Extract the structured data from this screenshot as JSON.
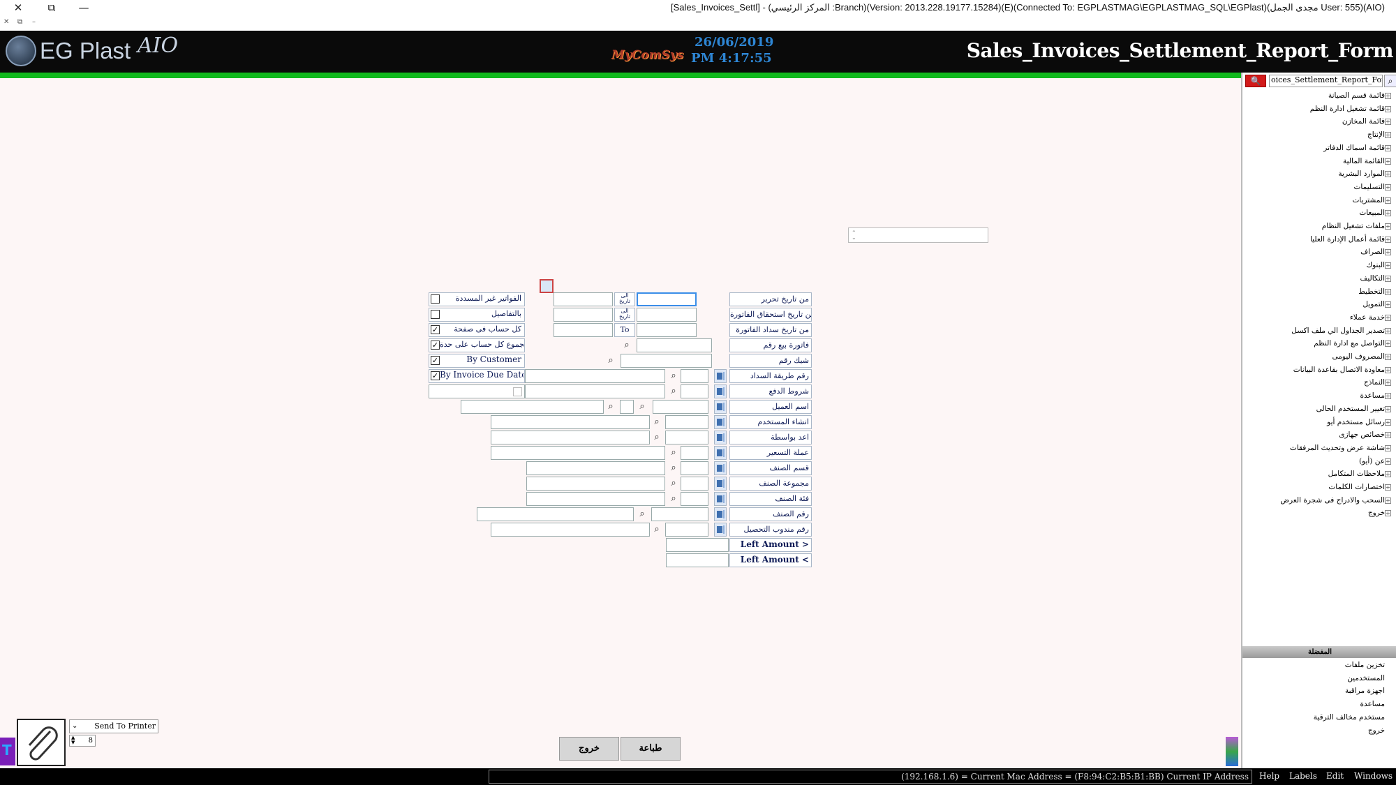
{
  "window": {
    "title": "[Sales_Invoices_Settl] - (المركز الرئيسي :Branch)(Version: 2013.228.19177.15284)(E)(Connected To: EGPLASTMAG\\EGPLASTMAG_SQL\\EGPlast)(مجدى الجمل User: 555)(AIO)",
    "close_icon": "✕",
    "restore_icon": "⧉",
    "minimize_icon": "—"
  },
  "header": {
    "logo_text": "EG Plast",
    "logo_aio": "AIO",
    "brand": "MyComSys",
    "date": "26/06/2019",
    "time": "PM 4:17:55",
    "form_title": "Sales_Invoices_Settlement_Report_Form"
  },
  "sidebar": {
    "search_value": "oices_Settlement_Report_Form",
    "search_go_icon": "search-icon",
    "tree_items": [
      "قائمة قسم الصيانة",
      "قائمة تشغيل ادارة النظم",
      "قائمة المخازن",
      "الإنتاج",
      "قائمة اسماك الدفاتر",
      "القائمة المالية",
      "الموارد البشرية",
      "التسليمات",
      "المشتريات",
      "المبيعات",
      "ملفات تشغيل النظام",
      "قائمة أعمال الإدارة العليا",
      "الصراف",
      "البنوك",
      "التكاليف",
      "التخطيط",
      "التمويل",
      "خدمة عملاء",
      "تصدير الجداول الي ملف اكسل",
      "التواصل مع ادارة النظم",
      "المصروف اليومى",
      "معاودة الاتصال بقاعدة البيانات",
      "النماذج",
      "مساعدة",
      "تغيير المستخدم الحالى",
      "رسائل مستخدم أيو",
      "خصائص جهازى",
      "شاشة عرض وتحديث المرفقات",
      "عن (أيو)",
      "ملاحظات المتكامل",
      "اختصارات الكلمات",
      "السحب والادراج فى شجرة العرض",
      "خروج"
    ],
    "favorites_header": "المفضلة",
    "favorites": [
      "تخزين ملفات",
      "المستخدمين",
      "اجهزة مراقبة",
      "مساعدة",
      "مستخدم مخالف الترقية",
      "خروج"
    ]
  },
  "form": {
    "rows": [
      {
        "label": "من تاريخ تحرير"
      },
      {
        "label": "من تاريخ استحقاق الفاتورة"
      },
      {
        "label": "من تاريخ سداد الفاتورة"
      },
      {
        "label": "فاتورة بيع رقم"
      },
      {
        "label": "شيك رقم"
      },
      {
        "label": "رقم طريقة السداد"
      },
      {
        "label": "شروط الدفع"
      },
      {
        "label": "اسم العميل"
      },
      {
        "label": "انشاء المستخدم"
      },
      {
        "label": "اعد بواسطة"
      },
      {
        "label": "عملة التسعير"
      },
      {
        "label": "قسم الصنف"
      },
      {
        "label": "مجموعة الصنف"
      },
      {
        "label": "فئة الصنف"
      },
      {
        "label": "رقم الصنف"
      },
      {
        "label": "رقم مندوب التحصيل"
      },
      {
        "label": "Left Amount >"
      },
      {
        "label": "Left Amount <"
      }
    ],
    "to_labels": [
      "الى تاريخ",
      "الى تاريخ",
      "To"
    ],
    "options": [
      {
        "label": "الفواتير غير المسددة",
        "checked": false
      },
      {
        "label": "بالتفاصيل",
        "checked": false
      },
      {
        "label": "كل حساب فى صفحة",
        "checked": true
      },
      {
        "label": "مجموع كل حساب على حدة",
        "checked": true
      },
      {
        "label": "By Customer",
        "checked": true
      },
      {
        "label": "By Invoice Due Date",
        "checked": true
      }
    ],
    "check_mark": "✓"
  },
  "bottom": {
    "print_target": "Send To Printer",
    "copies": "8",
    "print_button": "طباعة",
    "exit_button": "خروج",
    "paperclip_icon": "paperclip-icon"
  },
  "statusbar": {
    "text": "(192.168.1.6) = Current Mac Address = (F8:94:C2:B5:B1:BB) Current IP Address",
    "menu": [
      "Help",
      "Labels",
      "Edit",
      "Windows"
    ]
  },
  "colors": {
    "green_bar": "#11b81d",
    "header_bg": "#0a0a0a",
    "date_color": "#2e86d4",
    "search_red": "#d21a1a"
  }
}
